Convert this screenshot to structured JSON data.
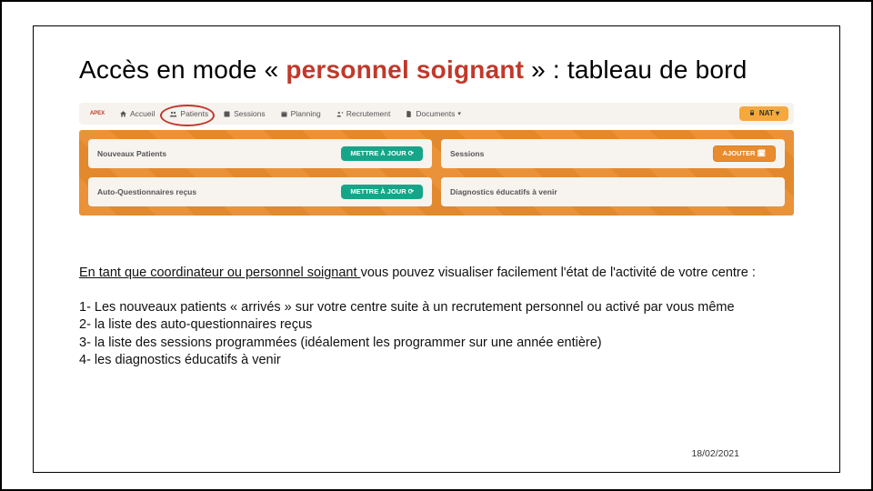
{
  "title": {
    "prefix": "Accès en mode «",
    "highlight": " personnel soignant ",
    "suffix": "» : tableau de bord"
  },
  "screenshot": {
    "logo_text": "APEX",
    "nav": {
      "accueil": "Accueil",
      "patients": "Patients",
      "sessions": "Sessions",
      "planning": "Planning",
      "recrutement": "Recrutement",
      "documents": "Documents"
    },
    "user_chip": "NAT ▾",
    "cards": {
      "nouveaux": {
        "label": "Nouveaux Patients",
        "button": "METTRE À JOUR  ⟳"
      },
      "autoq": {
        "label": "Auto-Questionnaires reçus",
        "button": "METTRE À JOUR  ⟳"
      },
      "sessions": {
        "label": "Sessions",
        "button": "AJOUTER  🗓"
      },
      "diagnostics": {
        "label": "Diagnostics éducatifs à venir"
      }
    }
  },
  "body": {
    "intro_underlined": "En tant que coordinateur ou personnel soignant ",
    "intro_rest": "vous pouvez visualiser facilement l'état de l'activité de votre centre :",
    "items": {
      "1": "1- Les nouveaux patients « arrivés » sur votre centre suite à un recrutement personnel ou activé par vous même",
      "2": "2- la liste des auto-questionnaires reçus",
      "3": "3- la liste des sessions programmées (idéalement les programmer sur une année entière)",
      "4": "4- les diagnostics éducatifs à venir"
    }
  },
  "date": "18/02/2021"
}
